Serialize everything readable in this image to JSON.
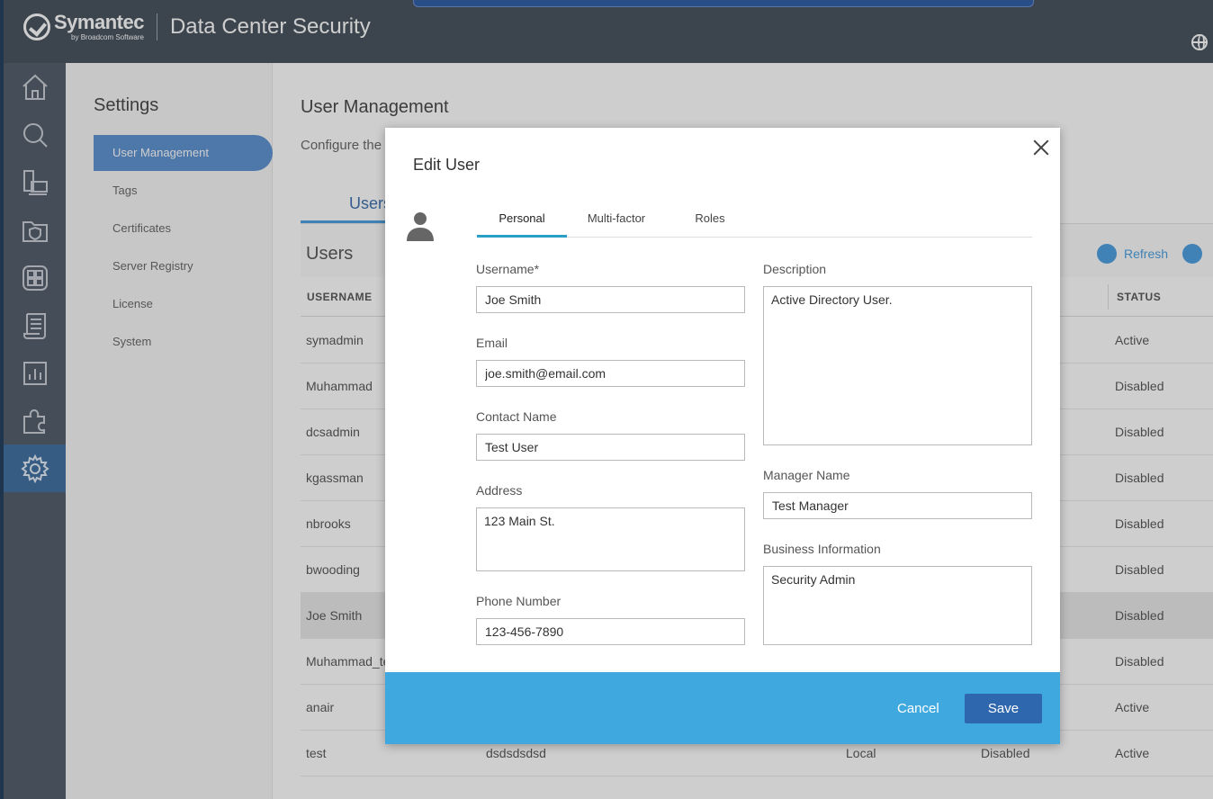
{
  "header": {
    "brand": "Symantec",
    "brand_sub": "by Broadcom Software",
    "product": "Data Center Security"
  },
  "nav_icons": [
    "home-icon",
    "search-icon",
    "assets-icon",
    "policies-icon",
    "dashboard-icon",
    "reports-icon",
    "monitors-icon",
    "extensions-icon",
    "settings-icon"
  ],
  "settings": {
    "title": "Settings",
    "items": [
      "User Management",
      "Tags",
      "Certificates",
      "Server Registry",
      "License",
      "System"
    ]
  },
  "main": {
    "title": "User Management",
    "description": "Configure the",
    "tab": "Users",
    "users_heading": "Users",
    "refresh_label": "Refresh",
    "columns": {
      "username": "USERNAME",
      "status": "STATUS"
    },
    "rows": [
      {
        "username": "symadmin",
        "col2": "",
        "col3": "",
        "col4": "",
        "status": "Active"
      },
      {
        "username": "Muhammad",
        "col2": "",
        "col3": "",
        "col4": "",
        "status": "Disabled"
      },
      {
        "username": "dcsadmin",
        "col2": "",
        "col3": "",
        "col4": "",
        "status": "Disabled"
      },
      {
        "username": "kgassman",
        "col2": "",
        "col3": "",
        "col4": "",
        "status": "Disabled"
      },
      {
        "username": "nbrooks",
        "col2": "",
        "col3": "",
        "col4": "",
        "status": "Disabled"
      },
      {
        "username": "bwooding",
        "col2": "",
        "col3": "",
        "col4": "",
        "status": "Disabled"
      },
      {
        "username": "Joe Smith",
        "col2": "",
        "col3": "",
        "col4": "",
        "status": "Disabled"
      },
      {
        "username": "Muhammad_te",
        "col2": "",
        "col3": "",
        "col4": "",
        "status": "Disabled"
      },
      {
        "username": "anair",
        "col2": "",
        "col3": "",
        "col4": "",
        "status": "Active"
      },
      {
        "username": "test",
        "col2": "dsdsdsdsd",
        "col3": "Local",
        "col4": "Disabled",
        "status": "Active"
      }
    ]
  },
  "modal": {
    "title": "Edit User",
    "tabs": [
      "Personal",
      "Multi-factor",
      "Roles"
    ],
    "fields": {
      "username": {
        "label": "Username*",
        "value": "Joe Smith"
      },
      "email": {
        "label": "Email",
        "value": "joe.smith@email.com"
      },
      "contact_name": {
        "label": "Contact Name",
        "value": "Test User"
      },
      "address": {
        "label": "Address",
        "value": "123 Main St."
      },
      "phone": {
        "label": "Phone Number",
        "value": "123-456-7890"
      },
      "description": {
        "label": "Description",
        "value": "Active Directory User."
      },
      "manager_name": {
        "label": "Manager Name",
        "value": "Test Manager"
      },
      "business_info": {
        "label": "Business Information",
        "value": "Security Admin"
      }
    },
    "cancel_label": "Cancel",
    "save_label": "Save"
  },
  "colors": {
    "accent": "#3fa9df",
    "save_button": "#2f67ae",
    "tab_underline": "#2a9fc6"
  }
}
